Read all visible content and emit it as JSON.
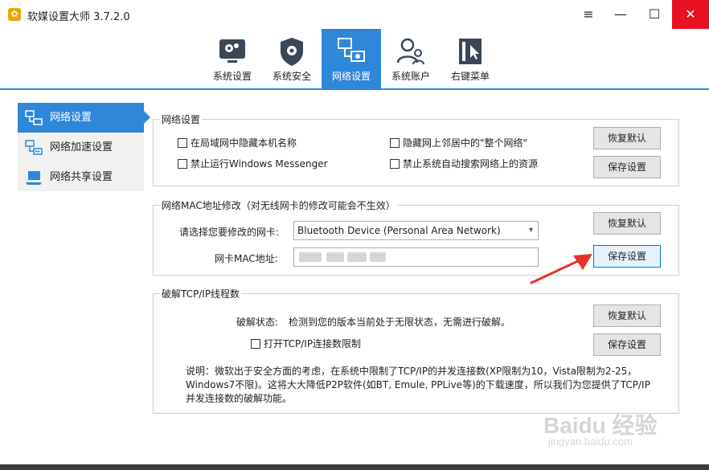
{
  "window": {
    "app_icon": "gear-app-icon",
    "title": "软媒设置大师 3.7.2.0",
    "menu_glyph": "≡",
    "min_glyph": "—",
    "max_glyph": "☐",
    "close_glyph": "✕"
  },
  "toolbar": {
    "tabs": [
      {
        "label": "系统设置",
        "icon": "system-settings-icon"
      },
      {
        "label": "系统安全",
        "icon": "shield-icon"
      },
      {
        "label": "网络设置",
        "icon": "network-icon",
        "active": true
      },
      {
        "label": "系统账户",
        "icon": "users-icon"
      },
      {
        "label": "右键菜单",
        "icon": "context-menu-icon"
      }
    ]
  },
  "sidebar": {
    "items": [
      {
        "label": "网络设置",
        "active": true
      },
      {
        "label": "网络加速设置"
      },
      {
        "label": "网络共享设置"
      }
    ]
  },
  "group_network": {
    "title": "网络设置",
    "options": [
      {
        "label": "在局域网中隐藏本机名称",
        "checked": false
      },
      {
        "label": "隐藏网上邻居中的\"整个网络\"",
        "checked": false
      },
      {
        "label": "禁止运行Windows Messenger",
        "checked": false
      },
      {
        "label": "禁止系统自动搜索网络上的资源",
        "checked": false
      }
    ],
    "restore": "恢复默认",
    "save": "保存设置"
  },
  "group_mac": {
    "title": "网络MAC地址修改（对无线网卡的修改可能会不生效）",
    "adapter_label": "请选择您要修改的网卡:",
    "adapter_value": "Bluetooth Device (Personal Area Network)",
    "mac_label": "网卡MAC地址:",
    "restore": "恢复默认",
    "save": "保存设置"
  },
  "group_tcp": {
    "title": "破解TCP/IP线程数",
    "status_label": "破解状态:",
    "status_value": "检测到您的版本当前处于无限状态，无需进行破解。",
    "open_limit": "打开TCP/IP连接数限制",
    "note_line1": "说明：微软出于安全方面的考虑，在系统中限制了TCP/IP的并发连接数(XP限制为10，Vista限制为2-25，",
    "note_line2": "Windows7不限)。这将大大降低P2P软件(如BT, Emule, PPLive等)的下载速度，所以我们为您提供了TCP/IP",
    "note_line3": "并发连接数的破解功能。",
    "restore": "恢复默认",
    "save": "保存设置"
  },
  "watermark": {
    "brand": "Baidu 经验",
    "url": "jingyan.baidu.com"
  },
  "colors": {
    "accent": "#2e87d8",
    "close_red": "#e81123",
    "annotation_red": "#e8312a"
  }
}
